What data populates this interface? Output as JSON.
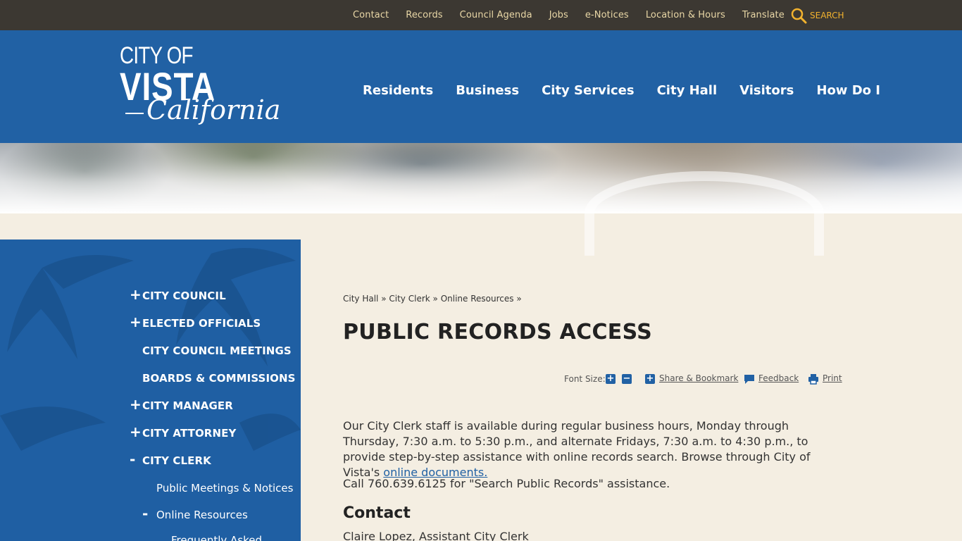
{
  "utility": {
    "links": [
      "Contact",
      "Records",
      "Council Agenda",
      "Jobs",
      "e-Notices",
      "Location & Hours",
      "Translate"
    ],
    "search_label": "SEARCH"
  },
  "logo": {
    "line1": "CITY OF",
    "line2": "VISTA",
    "line3": "California"
  },
  "nav": [
    "Residents",
    "Business",
    "City Services",
    "City Hall",
    "Visitors",
    "How Do I"
  ],
  "sidebar": {
    "items": [
      {
        "label": "CITY COUNCIL",
        "toggle": "+"
      },
      {
        "label": "ELECTED OFFICIALS",
        "toggle": "+"
      },
      {
        "label": "CITY COUNCIL MEETINGS",
        "toggle": ""
      },
      {
        "label": "BOARDS & COMMISSIONS",
        "toggle": ""
      },
      {
        "label": "CITY MANAGER",
        "toggle": "+"
      },
      {
        "label": "CITY ATTORNEY",
        "toggle": "+"
      },
      {
        "label": "CITY CLERK",
        "toggle": "-"
      }
    ],
    "sub_items": [
      {
        "label": "Public Meetings & Notices",
        "toggle": ""
      },
      {
        "label": "Online Resources",
        "toggle": "-"
      },
      {
        "label": "Frequently Asked",
        "toggle": ""
      }
    ]
  },
  "breadcrumb": {
    "items": [
      "City Hall",
      "City Clerk",
      "Online Resources"
    ],
    "separator": "»"
  },
  "page_title": "PUBLIC RECORDS ACCESS",
  "tools": {
    "font_size_label": "Font Size:",
    "increase": "+",
    "decrease": "−",
    "share_label": "Share & Bookmark",
    "feedback_label": "Feedback",
    "print_label": "Print"
  },
  "content": {
    "para1": "Our City Clerk staff is available during regular business hours, Monday through Thursday, 7:30 a.m. to 5:30 p.m., and alternate Fridays, 7:30 a.m. to 4:30 p.m., to provide step-by-step assistance with online records search. Browse through City of Vista's ",
    "para1_link": "online documents.",
    "para2": "Call 760.639.6125 for \"Search Public Records\" assistance.",
    "contact_heading": "Contact",
    "contact_name": "Claire Lopez, Assistant City Clerk"
  },
  "colors": {
    "utility_bg": "#3c3832",
    "header_blue": "#2161a4",
    "page_bg": "#f4eee2",
    "accent_gold": "#f2b22e"
  }
}
